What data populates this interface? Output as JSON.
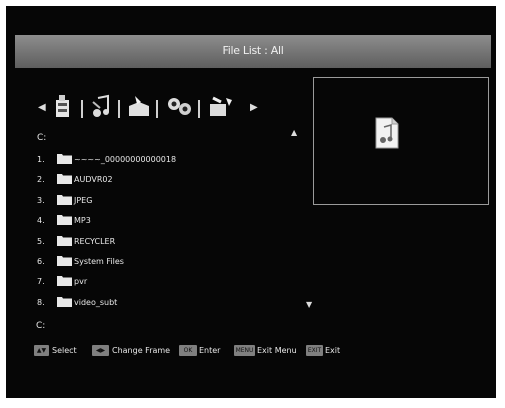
{
  "window": {
    "title": "File List : All"
  },
  "toolbar": {
    "icons": [
      {
        "name": "movie-icon"
      },
      {
        "name": "music-icon"
      },
      {
        "name": "photo-icon"
      },
      {
        "name": "settings-icon"
      },
      {
        "name": "record-icon"
      }
    ]
  },
  "browser": {
    "path": "C:",
    "bottom_path": "C:",
    "items": [
      {
        "index": "1.",
        "name": "~~~~_00000000000018"
      },
      {
        "index": "2.",
        "name": "AUDVR02"
      },
      {
        "index": "3.",
        "name": "JPEG"
      },
      {
        "index": "4.",
        "name": "MP3"
      },
      {
        "index": "5.",
        "name": "RECYCLER"
      },
      {
        "index": "6.",
        "name": "System Files"
      },
      {
        "index": "7.",
        "name": "pvr"
      },
      {
        "index": "8.",
        "name": "video_subt"
      }
    ]
  },
  "footer": {
    "select_key": "▲▼",
    "select_label": "Select",
    "frame_key": "◀▶",
    "frame_label": "Change Frame",
    "enter_key": "OK",
    "enter_label": "Enter",
    "menu_key": "MENU",
    "menu_label": "Exit Menu",
    "exit_key": "EXIT",
    "exit_label": "Exit"
  },
  "colors": {
    "title_bar": "#7a7a7a",
    "background": "#060606",
    "accent": "#d9d9d9"
  }
}
